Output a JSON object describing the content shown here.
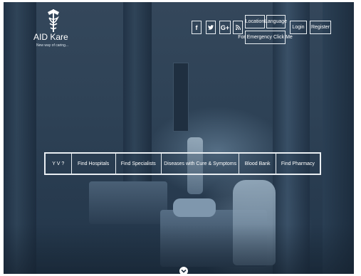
{
  "brand": {
    "name": "AID Kare",
    "tagline": "New way of caring..."
  },
  "social": {
    "facebook": "f",
    "twitter": "t",
    "googleplus": "G+",
    "rss": "rss-icon"
  },
  "header": {
    "location_label": "Location",
    "language_label": "Language",
    "emergency_label": "For Emergency Click Me",
    "login_label": "Login",
    "register_label": "Register"
  },
  "nav": {
    "items": [
      {
        "label": "Y V ?"
      },
      {
        "label": "Find Hospitals"
      },
      {
        "label": "Find Specialists"
      },
      {
        "label": "Diseases with Cure & Symptoms"
      },
      {
        "label": "Blood Bank"
      },
      {
        "label": "Find Pharmacy"
      }
    ]
  },
  "scroll": {
    "icon": "chevron-down-icon"
  },
  "colors": {
    "overlay": "#2e4256",
    "border": "#e9eef2",
    "text": "#ffffff"
  }
}
